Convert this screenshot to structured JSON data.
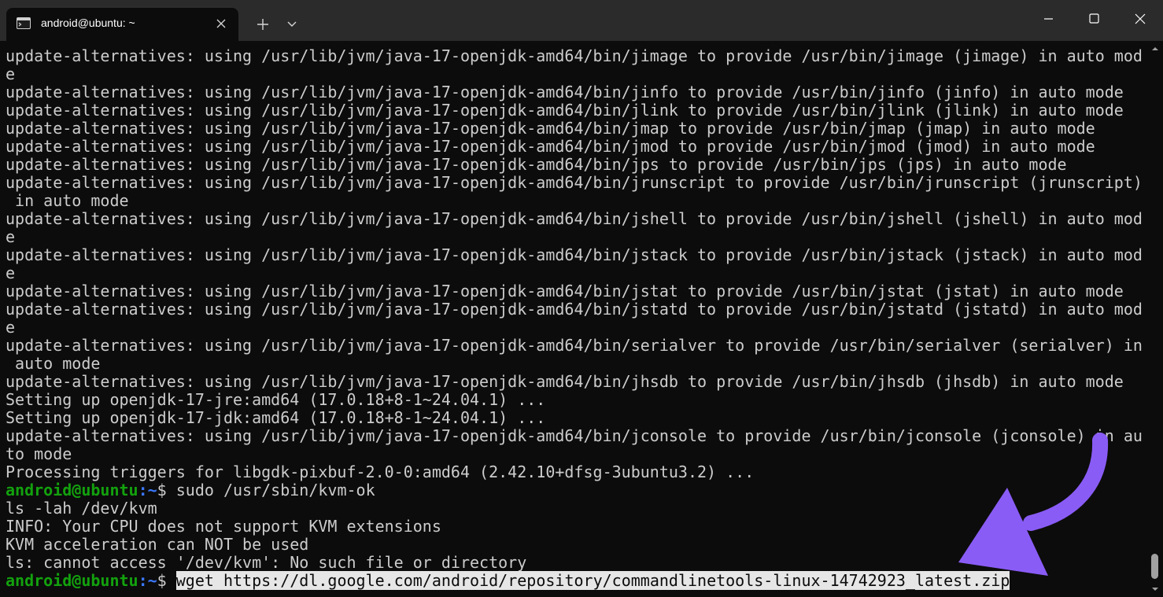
{
  "window": {
    "tab_title": "android@ubuntu: ~",
    "icons": {
      "tab": "terminal-icon",
      "close_tab": "close-icon",
      "new_tab": "plus-icon",
      "dropdown": "chevron-down-icon",
      "minimize": "minimize-icon",
      "maximize": "maximize-icon",
      "close_window": "close-icon"
    }
  },
  "colors": {
    "background": "#0c0c0c",
    "titlebar": "#2b2b2b",
    "text": "#cccccc",
    "prompt_user": "#13a10e",
    "prompt_path": "#3b78ff",
    "selection": "#e6e6e6",
    "annotation_arrow": "#8a5cf6"
  },
  "terminal": {
    "lines": [
      "update-alternatives: using /usr/lib/jvm/java-17-openjdk-amd64/bin/jimage to provide /usr/bin/jimage (jimage) in auto mod",
      "e",
      "update-alternatives: using /usr/lib/jvm/java-17-openjdk-amd64/bin/jinfo to provide /usr/bin/jinfo (jinfo) in auto mode",
      "update-alternatives: using /usr/lib/jvm/java-17-openjdk-amd64/bin/jlink to provide /usr/bin/jlink (jlink) in auto mode",
      "update-alternatives: using /usr/lib/jvm/java-17-openjdk-amd64/bin/jmap to provide /usr/bin/jmap (jmap) in auto mode",
      "update-alternatives: using /usr/lib/jvm/java-17-openjdk-amd64/bin/jmod to provide /usr/bin/jmod (jmod) in auto mode",
      "update-alternatives: using /usr/lib/jvm/java-17-openjdk-amd64/bin/jps to provide /usr/bin/jps (jps) in auto mode",
      "update-alternatives: using /usr/lib/jvm/java-17-openjdk-amd64/bin/jrunscript to provide /usr/bin/jrunscript (jrunscript)",
      " in auto mode",
      "update-alternatives: using /usr/lib/jvm/java-17-openjdk-amd64/bin/jshell to provide /usr/bin/jshell (jshell) in auto mod",
      "e",
      "update-alternatives: using /usr/lib/jvm/java-17-openjdk-amd64/bin/jstack to provide /usr/bin/jstack (jstack) in auto mod",
      "e",
      "update-alternatives: using /usr/lib/jvm/java-17-openjdk-amd64/bin/jstat to provide /usr/bin/jstat (jstat) in auto mode",
      "update-alternatives: using /usr/lib/jvm/java-17-openjdk-amd64/bin/jstatd to provide /usr/bin/jstatd (jstatd) in auto mod",
      "e",
      "update-alternatives: using /usr/lib/jvm/java-17-openjdk-amd64/bin/serialver to provide /usr/bin/serialver (serialver) in",
      " auto mode",
      "update-alternatives: using /usr/lib/jvm/java-17-openjdk-amd64/bin/jhsdb to provide /usr/bin/jhsdb (jhsdb) in auto mode",
      "Setting up openjdk-17-jre:amd64 (17.0.18+8-1~24.04.1) ...",
      "Setting up openjdk-17-jdk:amd64 (17.0.18+8-1~24.04.1) ...",
      "update-alternatives: using /usr/lib/jvm/java-17-openjdk-amd64/bin/jconsole to provide /usr/bin/jconsole (jconsole) in au",
      "to mode",
      "Processing triggers for libgdk-pixbuf-2.0-0:amd64 (2.42.10+dfsg-3ubuntu3.2) ..."
    ],
    "prompt1": {
      "user_host": "android@ubuntu",
      "path": ":~",
      "symbol": "$ ",
      "command": "sudo /usr/sbin/kvm-ok"
    },
    "lines_after": [
      "ls -lah /dev/kvm",
      "INFO: Your CPU does not support KVM extensions",
      "KVM acceleration can NOT be used",
      "ls: cannot access '/dev/kvm': No such file or directory"
    ],
    "prompt2": {
      "user_host": "android@ubuntu",
      "path": ":~",
      "symbol": "$ ",
      "command": "wget https://dl.google.com/android/repository/commandlinetools-linux-14742923_latest.zip"
    }
  }
}
